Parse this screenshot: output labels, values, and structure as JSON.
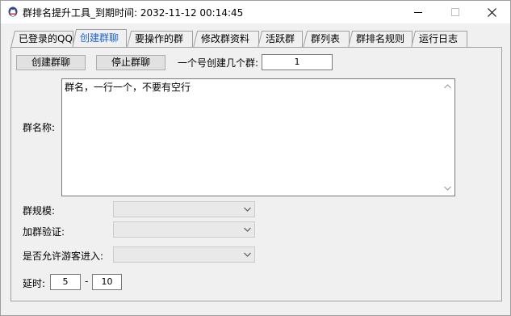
{
  "window": {
    "title": "群排名提升工具_到期时间: 2032-11-12 00:14:45"
  },
  "tabs": [
    {
      "label": "已登录的QQ",
      "active": false
    },
    {
      "label": "创建群聊",
      "active": true
    },
    {
      "label": "要操作的群",
      "active": false
    },
    {
      "label": "修改群资料",
      "active": false
    },
    {
      "label": "活跃群",
      "active": false
    },
    {
      "label": "群列表",
      "active": false
    },
    {
      "label": "群排名规则",
      "active": false
    },
    {
      "label": "运行日志",
      "active": false
    }
  ],
  "create_panel": {
    "create_button": "创建群聊",
    "stop_button": "停止群聊",
    "per_account_label": "一个号创建几个群:",
    "per_account_value": "1",
    "group_name_label": "群名称:",
    "group_name_text": "群名，一行一个，不要有空行",
    "scale_label": "群规模:",
    "scale_value": "",
    "verify_label": "加群验证:",
    "verify_value": "",
    "guest_label": "是否允许游客进入:",
    "guest_value": "",
    "delay_label": "延时:",
    "delay_min": "5",
    "delay_separator": "-",
    "delay_max": "10"
  },
  "icons": {
    "app": "qq-penguin-icon",
    "minimize": "minimize-icon",
    "maximize": "maximize-icon",
    "close": "close-icon"
  },
  "colors": {
    "active_tab_text": "#1e64c8",
    "panel_bg": "#f0f0f0",
    "titlebar_bg": "#ffffff"
  }
}
